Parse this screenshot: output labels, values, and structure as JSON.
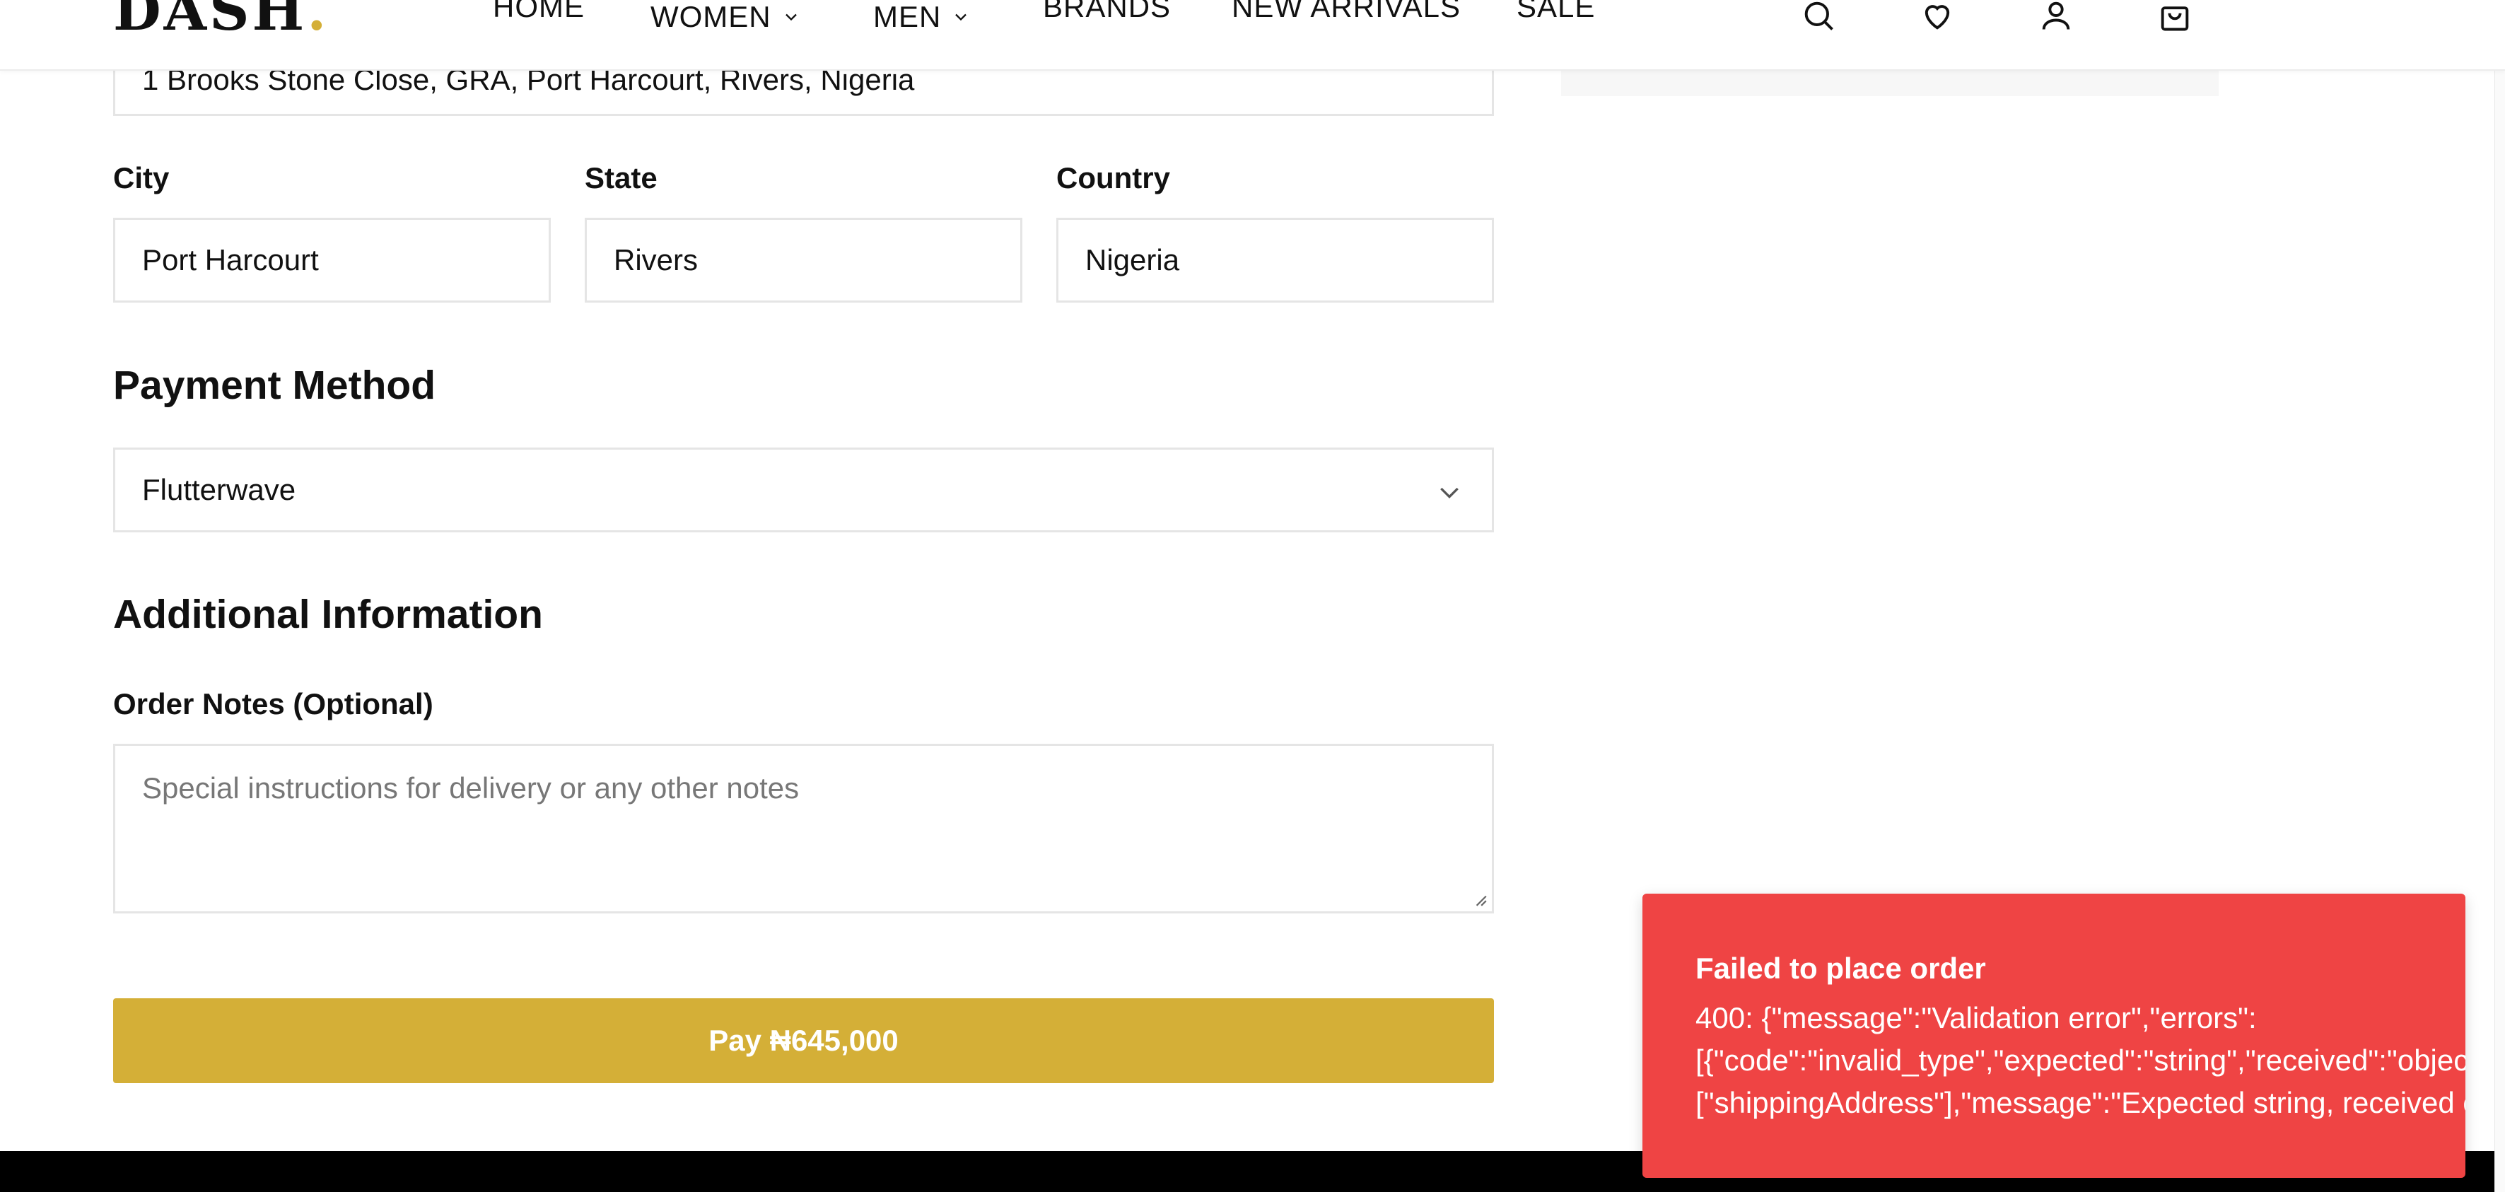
{
  "header": {
    "logo_text": "DASH",
    "logo_dot": ".",
    "nav": [
      {
        "label": "HOME"
      },
      {
        "label": "WOMEN"
      },
      {
        "label": "MEN"
      },
      {
        "label": "BRANDS"
      },
      {
        "label": "NEW ARRIVALS"
      },
      {
        "label": "SALE"
      }
    ],
    "icons": [
      "search-icon",
      "heart-icon",
      "user-icon",
      "bag-icon"
    ]
  },
  "shipping": {
    "address_value": "1 Brooks Stone Close, GRA, Port Harcourt, Rivers, Nigeria",
    "city_label": "City",
    "city_value": "Port Harcourt",
    "state_label": "State",
    "state_value": "Rivers",
    "country_label": "Country",
    "country_value": "Nigeria"
  },
  "payment": {
    "title": "Payment Method",
    "selected": "Flutterwave"
  },
  "additional": {
    "title": "Additional Information",
    "notes_label": "Order Notes (Optional)",
    "notes_placeholder": "Special instructions for delivery or any other notes"
  },
  "pay_button": {
    "label": "Pay ₦645,000"
  },
  "toast": {
    "title": "Failed to place order",
    "line1": "400: {\"message\":\"Validation error\",\"errors\":",
    "line2": "[{\"code\":\"invalid_type\",\"expected\":\"string\",\"received\":\"object\",\"path\":",
    "line3": "[\"shippingAddress\"],\"message\":\"Expected string, received object\"}]}"
  },
  "colors": {
    "accent": "#d4af37",
    "error": "#ef4444",
    "border": "#e5e5e5"
  }
}
